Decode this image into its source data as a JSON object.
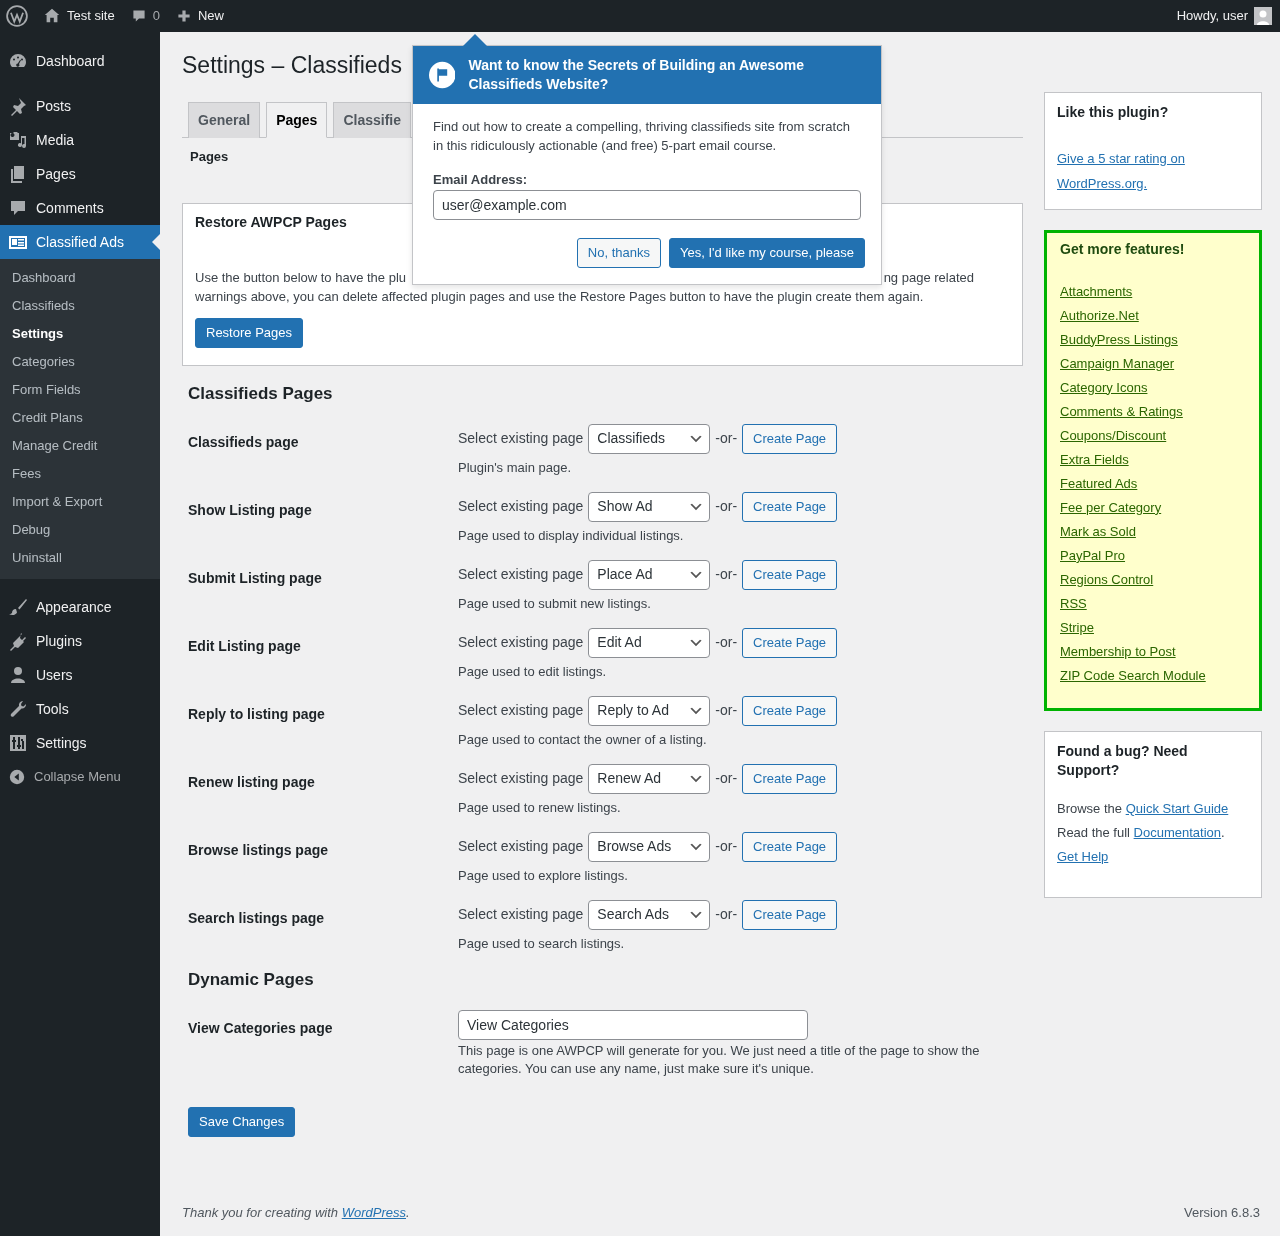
{
  "admin_bar": {
    "site": "Test site",
    "comments": "0",
    "new": "New",
    "greeting": "Howdy, user"
  },
  "sidebar": {
    "groups": [
      [
        {
          "label": "Dashboard",
          "selected": false
        }
      ],
      [
        {
          "label": "Posts",
          "selected": false
        },
        {
          "label": "Media",
          "selected": false
        },
        {
          "label": "Pages",
          "selected": false
        },
        {
          "label": "Comments",
          "selected": false
        },
        {
          "label": "Classified Ads",
          "selected": true,
          "children": [
            {
              "label": "Dashboard",
              "selected": false
            },
            {
              "label": "Classifieds",
              "selected": false
            },
            {
              "label": "Settings",
              "selected": true
            },
            {
              "label": "Categories",
              "selected": false
            },
            {
              "label": "Form Fields",
              "selected": false
            },
            {
              "label": "Credit Plans",
              "selected": false
            },
            {
              "label": "Manage Credit",
              "selected": false
            },
            {
              "label": "Fees",
              "selected": false
            },
            {
              "label": "Import & Export",
              "selected": false
            },
            {
              "label": "Debug",
              "selected": false
            },
            {
              "label": "Uninstall",
              "selected": false
            }
          ]
        }
      ],
      [
        {
          "label": "Appearance",
          "selected": false
        },
        {
          "label": "Plugins",
          "selected": false
        },
        {
          "label": "Users",
          "selected": false
        },
        {
          "label": "Tools",
          "selected": false
        },
        {
          "label": "Settings",
          "selected": false
        }
      ]
    ],
    "collapse": "Collapse Menu"
  },
  "page": {
    "title": "Settings – Classifieds",
    "tabs": [
      {
        "label": "General",
        "selected": false
      },
      {
        "label": "Pages",
        "selected": true
      },
      {
        "label": "Classifie",
        "selected": false
      }
    ],
    "subtitle": "Pages",
    "restore": {
      "title": "Restore AWPCP Pages",
      "line_1_start": "Use the button below to have the plu",
      "line_1_end": "ng page related",
      "line_2": "warnings above, you can delete affected plugin pages and use the Restore Pages button to have the plugin create them again.",
      "button": "Restore Pages"
    },
    "sections": [
      {
        "heading": "Classifieds Pages",
        "rows": [
          {
            "label": "Classifieds page",
            "prompt": "Select existing page",
            "value": "Classifieds",
            "or": "-or-",
            "button": "Create Page",
            "help": "Plugin's main page."
          },
          {
            "label": "Show Listing page",
            "prompt": "Select existing page",
            "value": "Show Ad",
            "or": "-or-",
            "button": "Create Page",
            "help": "Page used to display individual listings."
          },
          {
            "label": "Submit Listing page",
            "prompt": "Select existing page",
            "value": "Place Ad",
            "or": "-or-",
            "button": "Create Page",
            "help": "Page used to submit new listings."
          },
          {
            "label": "Edit Listing page",
            "prompt": "Select existing page",
            "value": "Edit Ad",
            "or": "-or-",
            "button": "Create Page",
            "help": "Page used to edit listings."
          },
          {
            "label": "Reply to listing page",
            "prompt": "Select existing page",
            "value": "Reply to Ad",
            "or": "-or-",
            "button": "Create Page",
            "help": "Page used to contact the owner of a listing."
          },
          {
            "label": "Renew listing page",
            "prompt": "Select existing page",
            "value": "Renew Ad",
            "or": "-or-",
            "button": "Create Page",
            "help": "Page used to renew listings."
          },
          {
            "label": "Browse listings page",
            "prompt": "Select existing page",
            "value": "Browse Ads",
            "or": "-or-",
            "button": "Create Page",
            "help": "Page used to explore listings."
          },
          {
            "label": "Search listings page",
            "prompt": "Select existing page",
            "value": "Search Ads",
            "or": "-or-",
            "button": "Create Page",
            "help": "Page used to search listings."
          }
        ]
      }
    ],
    "dynamic": {
      "heading": "Dynamic Pages",
      "rows": [
        {
          "label": "View Categories page",
          "value": "View Categories",
          "help": "This page is one AWPCP will generate for you. We just need a title of the page to show the categories. You can use any name, just make sure it's unique."
        }
      ]
    },
    "save": "Save Changes"
  },
  "side": {
    "like": {
      "title": "Like this plugin?",
      "link": "Give a 5 star rating on WordPress.org."
    },
    "features": {
      "title": "Get more features!",
      "links": [
        "Attachments",
        "Authorize.Net",
        "BuddyPress Listings",
        "Campaign Manager",
        "Category Icons",
        "Comments & Ratings",
        "Coupons/Discount",
        "Extra Fields",
        "Featured Ads",
        "Fee per Category",
        "Mark as Sold",
        "PayPal Pro",
        "Regions Control",
        "RSS",
        "Stripe",
        "Membership to Post",
        "ZIP Code Search Module"
      ]
    },
    "support": {
      "title": "Found a bug? Need Support?",
      "lines": [
        {
          "before": "Browse the",
          "link": "Quick Start Guide"
        },
        {
          "before": "Read the full",
          "link": "Documentation",
          "after": "."
        },
        {
          "link": "Get Help"
        }
      ]
    }
  },
  "popup": {
    "title": "Want to know the Secrets of Building an Awesome Classifieds Website?",
    "text": "Find out how to create a compelling, thriving classifieds site from scratch in this ridiculously actionable (and free) 5-part email course.",
    "email_label": "Email Address:",
    "email_value": "user@example.com",
    "buttons": [
      {
        "label": "No, thanks",
        "kind": "secondary"
      },
      {
        "label": "Yes, I'd like my course, please",
        "kind": "primary"
      }
    ]
  },
  "footer": {
    "before": "Thank you for creating with",
    "link": "WordPress",
    "after": ".",
    "version": "Version 6.8.3"
  }
}
